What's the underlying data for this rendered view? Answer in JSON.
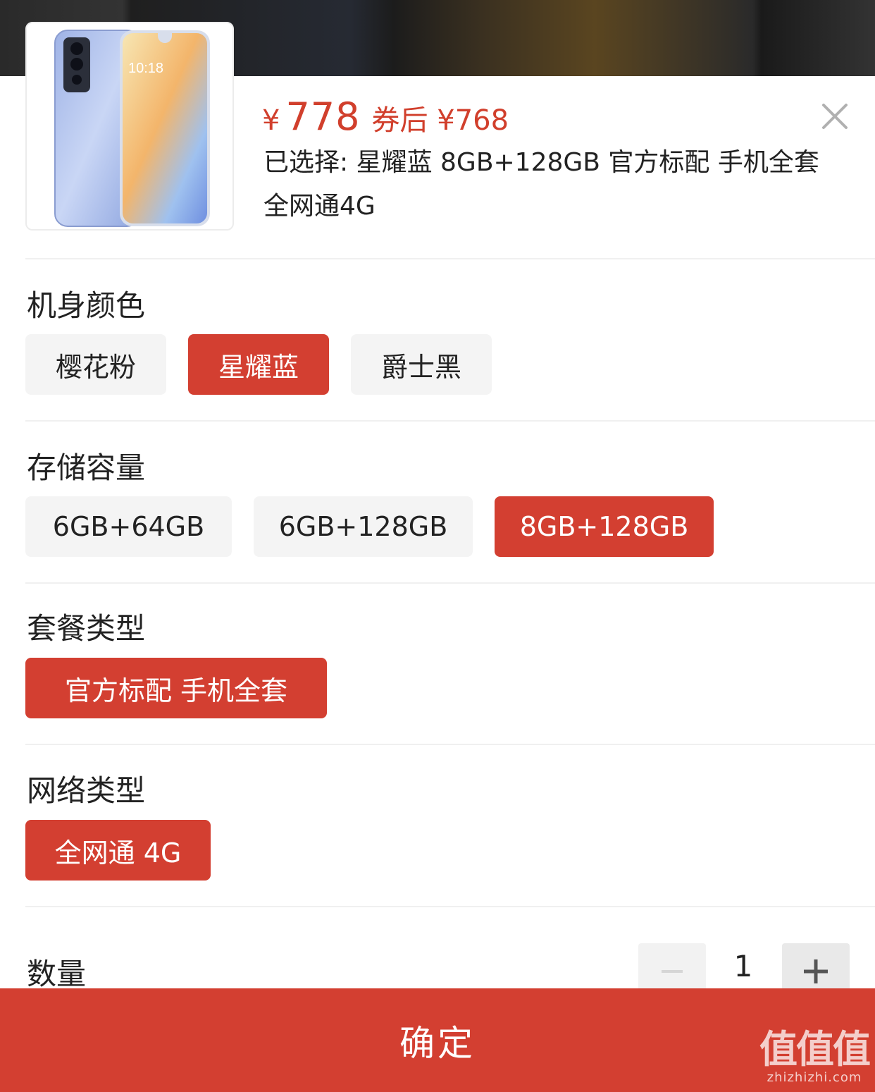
{
  "price": {
    "symbol": "¥",
    "value": "778",
    "coupon": "券后 ¥768"
  },
  "selected_text": "已选择: 星耀蓝 8GB+128GB 官方标配 手机全套 全网通4G",
  "product_image": {
    "screen_time": "10:18"
  },
  "sections": {
    "color": {
      "title": "机身颜色",
      "options": [
        "樱花粉",
        "星耀蓝",
        "爵士黑"
      ],
      "selected": "星耀蓝"
    },
    "storage": {
      "title": "存储容量",
      "options": [
        "6GB+64GB",
        "6GB+128GB",
        "8GB+128GB"
      ],
      "selected": "8GB+128GB"
    },
    "package": {
      "title": "套餐类型",
      "options": [
        "官方标配 手机全套"
      ],
      "selected": "官方标配 手机全套"
    },
    "network": {
      "title": "网络类型",
      "options": [
        "全网通 4G"
      ],
      "selected": "全网通 4G"
    }
  },
  "quantity": {
    "label": "数量",
    "value": "1"
  },
  "confirm_label": "确定",
  "watermark": {
    "big": "值值值",
    "small": "zhizhizhi.com"
  },
  "colors": {
    "accent": "#d33f31",
    "option_bg": "#f4f4f4"
  }
}
